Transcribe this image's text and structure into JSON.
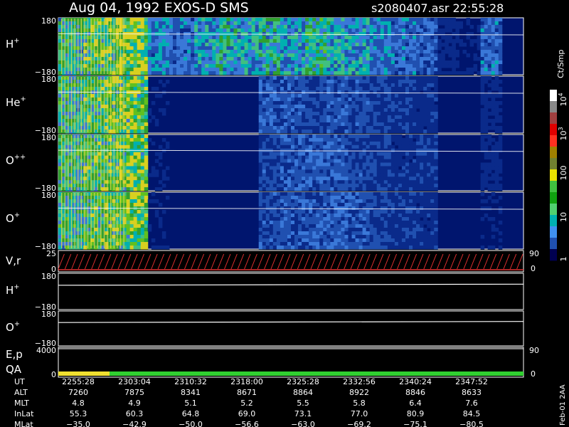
{
  "header": {
    "title": "Aug 04, 1992   EXOS-D SMS",
    "file_time": "s2080407.asr  22:55:28"
  },
  "colorbar": {
    "unit_label": "Ct/Smp",
    "ticks": [
      {
        "label": "10",
        "sup": "4",
        "value": 10000
      },
      {
        "label": "10",
        "sup": "3",
        "value": 1000
      },
      {
        "label": "100",
        "sup": "",
        "value": 100
      },
      {
        "label": "10",
        "sup": "",
        "value": 10
      },
      {
        "label": "1",
        "sup": "",
        "value": 1
      }
    ],
    "colors": [
      "#ffffff",
      "#888888",
      "#a04040",
      "#e00000",
      "#ff3020",
      "#a08000",
      "#708030",
      "#e8e000",
      "#40c040",
      "#10a010",
      "#50d070",
      "#00b0b0",
      "#4090f0",
      "#2050b0",
      "#000050"
    ]
  },
  "footer": {
    "stamp": "Feb-01 2AA",
    "row_labels": [
      "UT",
      "ALT",
      "MLT",
      "InLat",
      "MLat"
    ],
    "columns": [
      {
        "UT": "2255:28",
        "ALT": "7260",
        "MLT": "4.8",
        "InLat": "55.3",
        "MLat": "-35.0"
      },
      {
        "UT": "2303:04",
        "ALT": "7875",
        "MLT": "4.9",
        "InLat": "60.3",
        "MLat": "-42.9"
      },
      {
        "UT": "2310:32",
        "ALT": "8341",
        "MLT": "5.1",
        "InLat": "64.8",
        "MLat": "-50.0"
      },
      {
        "UT": "2318:00",
        "ALT": "8671",
        "MLT": "5.2",
        "InLat": "69.0",
        "MLat": "-56.6"
      },
      {
        "UT": "2325:28",
        "ALT": "8864",
        "MLT": "5.5",
        "InLat": "73.1",
        "MLat": "-63.0"
      },
      {
        "UT": "2332:56",
        "ALT": "8922",
        "MLT": "5.8",
        "InLat": "77.0",
        "MLat": "-69.2"
      },
      {
        "UT": "2340:24",
        "ALT": "8846",
        "MLT": "6.4",
        "InLat": "80.9",
        "MLat": "-75.1"
      },
      {
        "UT": "2347:52",
        "ALT": "8633",
        "MLT": "7.6",
        "InLat": "84.5",
        "MLat": "-80.5"
      }
    ]
  },
  "colors": {
    "spectrogram_background": "#00156e",
    "trace": "#ffffff",
    "velocity_trace": "#e03030",
    "qa_good": "#30d030",
    "qa_warn": "#f0e030"
  },
  "chart_data": [
    {
      "type": "heatmap",
      "panel": "H+",
      "label": "H",
      "sup": "+",
      "yticks": [
        "180",
        "−180"
      ],
      "ylim": [
        -180,
        180
      ],
      "x": [
        "2255:28",
        "2303:04",
        "2310:32",
        "2318:00",
        "2325:28",
        "2332:56",
        "2340:24",
        "2347:52"
      ],
      "intensity_profile": [
        60,
        70,
        80,
        85,
        40,
        35,
        45,
        55,
        50,
        55,
        45,
        60,
        50,
        45,
        40,
        35,
        30,
        15,
        10,
        35,
        5
      ],
      "trace_y": 140
    },
    {
      "type": "heatmap",
      "panel": "He+",
      "label": "He",
      "sup": "+",
      "yticks": [
        "180",
        "−180"
      ],
      "ylim": [
        -180,
        180
      ],
      "intensity_profile": [
        60,
        70,
        75,
        80,
        10,
        3,
        2,
        2,
        2,
        30,
        28,
        25,
        28,
        25,
        22,
        20,
        18,
        0,
        0,
        15,
        0
      ],
      "trace_y": 140
    },
    {
      "type": "heatmap",
      "panel": "O++",
      "label": "O",
      "sup": "++",
      "yticks": [
        "180",
        "−180"
      ],
      "ylim": [
        -180,
        180
      ],
      "intensity_profile": [
        60,
        70,
        75,
        80,
        10,
        3,
        2,
        2,
        2,
        25,
        28,
        30,
        30,
        25,
        22,
        18,
        20,
        0,
        0,
        15,
        0
      ],
      "trace_y": 140
    },
    {
      "type": "heatmap",
      "panel": "O+",
      "label": "O",
      "sup": "+",
      "yticks": [
        "180",
        "−180"
      ],
      "ylim": [
        -180,
        180
      ],
      "intensity_profile": [
        60,
        70,
        75,
        80,
        10,
        3,
        2,
        2,
        2,
        25,
        28,
        30,
        30,
        28,
        24,
        20,
        18,
        0,
        0,
        10,
        0
      ],
      "trace_y": 140
    },
    {
      "type": "line",
      "panel": "V,r",
      "label": "V,r",
      "yticks": [
        "25",
        "0"
      ],
      "right_ticks": [
        "90",
        "0"
      ]
    },
    {
      "type": "line",
      "panel": "H+ attitude",
      "label": "H",
      "sup": "+",
      "yticks": [
        "180",
        "−180"
      ],
      "trace_y": 120
    },
    {
      "type": "line",
      "panel": "O+ attitude",
      "label": "O",
      "sup": "+",
      "yticks": [
        "180",
        "−180"
      ],
      "trace_y": 120
    },
    {
      "type": "line",
      "panel": "E,p QA",
      "label": "E,p",
      "label2": "QA",
      "yticks": [
        "4000",
        "0"
      ],
      "right_ticks": [
        "90",
        "0"
      ]
    }
  ]
}
